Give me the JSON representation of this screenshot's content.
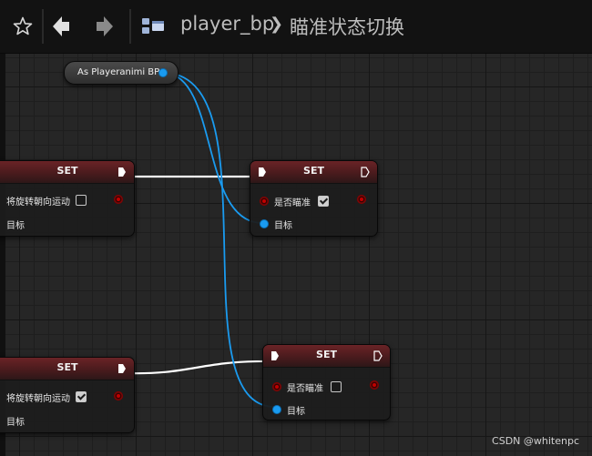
{
  "toolbar": {
    "breadcrumb_root": "player_bp",
    "breadcrumb_separator": "❯",
    "breadcrumb_current": "瞄准状态切换"
  },
  "icons": {
    "favorite": "star-icon",
    "back": "arrow-left-icon",
    "forward": "arrow-right-icon",
    "blueprint": "blueprint-graph-icon"
  },
  "colors": {
    "node_header": "#6a2326",
    "object_pin": "#1a9bf0",
    "bool_pin": "#c00000",
    "exec_wire": "#ffffff"
  },
  "graph": {
    "getter_node": {
      "label": "As Playeranimi BP"
    },
    "nodes": [
      {
        "title": "SET",
        "bool_label": "将旋转朝向运动",
        "bool_checked": false,
        "target_label": "目标"
      },
      {
        "title": "SET",
        "bool_label": "是否瞄准",
        "bool_checked": true,
        "target_label": "目标"
      },
      {
        "title": "SET",
        "bool_label": "将旋转朝向运动",
        "bool_checked": true,
        "target_label": "目标"
      },
      {
        "title": "SET",
        "bool_label": "是否瞄准",
        "bool_checked": false,
        "target_label": "目标"
      }
    ]
  },
  "watermark": "CSDN @whitenpc"
}
